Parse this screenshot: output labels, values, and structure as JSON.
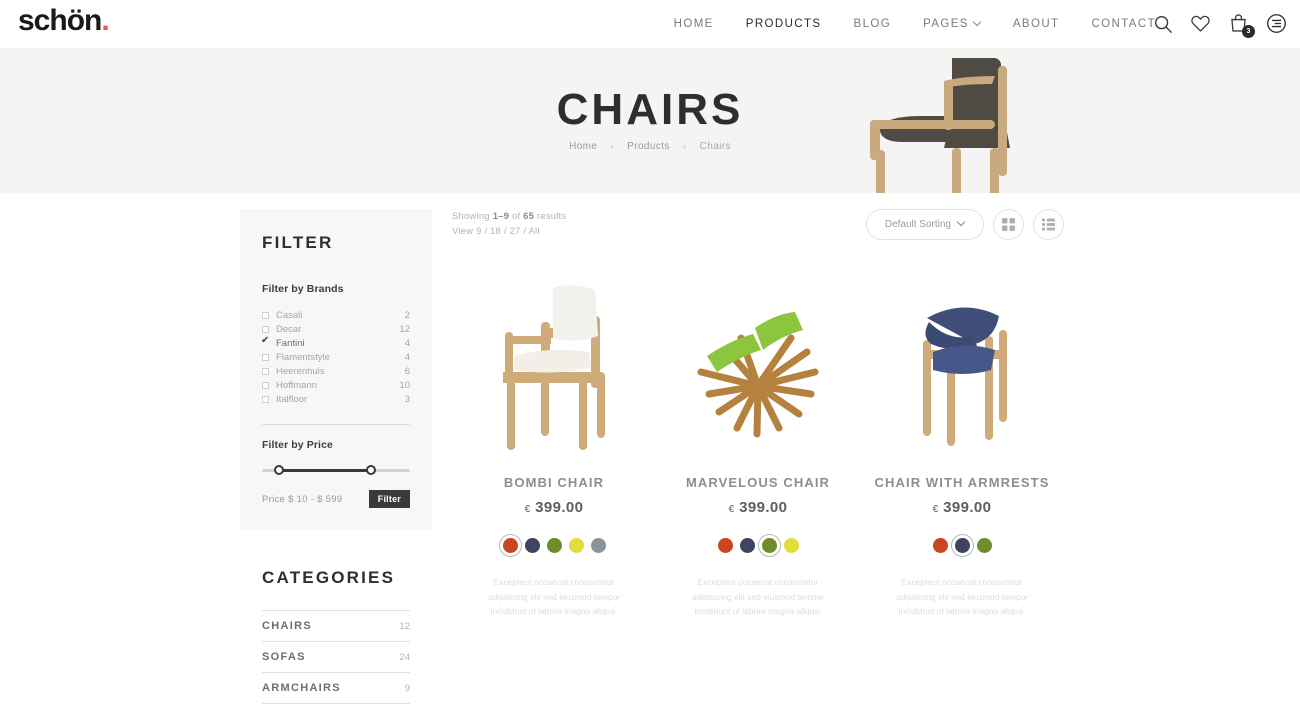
{
  "brand": {
    "name": "schön",
    "dot": "."
  },
  "nav": {
    "items": [
      {
        "label": "HOME",
        "active": false
      },
      {
        "label": "PRODUCTS",
        "active": true
      },
      {
        "label": "BLOG",
        "active": false
      },
      {
        "label": "PAGES",
        "active": false,
        "caret": true
      },
      {
        "label": "ABOUT",
        "active": false
      },
      {
        "label": "CONTACT",
        "active": false
      }
    ],
    "icons": [
      "search-icon",
      "wishlist-heart-icon",
      "cart-bag-icon",
      "menu-circle-icon"
    ],
    "cart_count": "3"
  },
  "hero": {
    "title": "CHAIRS",
    "breadcrumb": {
      "home": "Home",
      "products": "Products",
      "current": "Chairs",
      "separator": "›"
    }
  },
  "toolbar": {
    "showing_prefix": "Showing ",
    "showing_range": "1–9",
    "showing_mid": " of ",
    "showing_total": "65",
    "showing_suffix": " results",
    "view_label": "View 9 / 18 / 27 / All",
    "sort_label": "Default Sorting",
    "grid_view": "grid-view-icon",
    "list_view": "list-view-icon"
  },
  "filter": {
    "heading": "FILTER",
    "brands_label": "Filter by Brands",
    "brands": [
      {
        "name": "Casali",
        "count": "2",
        "checked": false
      },
      {
        "name": "Decar",
        "count": "12",
        "checked": false
      },
      {
        "name": "Fantini",
        "count": "4",
        "checked": true
      },
      {
        "name": "Flamentstyle",
        "count": "4",
        "checked": false
      },
      {
        "name": "Heerenhuis",
        "count": "6",
        "checked": false
      },
      {
        "name": "Hoffmann",
        "count": "10",
        "checked": false
      },
      {
        "name": "Italfloor",
        "count": "3",
        "checked": false
      }
    ],
    "price_label": "Filter by Price",
    "price_range_text": "Price  $ 10  -  $ 599",
    "price_min": "$ 10",
    "price_max": "$ 599",
    "filter_button": "Filter"
  },
  "categories": {
    "heading": "CATEGORIES",
    "items": [
      {
        "name": "CHAIRS",
        "count": "12"
      },
      {
        "name": "SOFAS",
        "count": "24"
      },
      {
        "name": "ARMCHAIRS",
        "count": "9"
      }
    ]
  },
  "products": [
    {
      "name": "BOMBI CHAIR",
      "currency": "€",
      "price": "399.00",
      "image": "bombi-chair-photo",
      "swatches": [
        "#c8451f",
        "#3d4361",
        "#6f8c2a",
        "#e2dc3c",
        "#8b9399"
      ],
      "selected_swatch": 0,
      "desc": "Excepteur occaecat consectetur adipisicing elit sed eiusmod tempor incididunt ut labore magna aliqua."
    },
    {
      "name": "MARVELOUS CHAIR",
      "currency": "€",
      "price": "399.00",
      "image": "marvelous-chair-photo",
      "swatches": [
        "#c8451f",
        "#3d4361",
        "#6f8c2a",
        "#e2dc3c"
      ],
      "selected_swatch": 2,
      "desc": "Excepteur occaecat consectetur adipisicing elit sed eiusmod tempor incididunt ut labore magna aliqua."
    },
    {
      "name": "CHAIR WITH ARMRESTS",
      "currency": "€",
      "price": "399.00",
      "image": "chair-with-armrests-photo",
      "swatches": [
        "#c8451f",
        "#3d4361",
        "#6f8c2a"
      ],
      "selected_swatch": 1,
      "desc": "Excepteur occaecat consectetur adipisicing elit sed eiusmod tempor incididunt ut labore magna aliqua."
    }
  ],
  "colors": {
    "accent": "#e8594a",
    "hero_bg": "#f4f4f2",
    "sidebar_bg": "#f7f7f6",
    "dark": "#3a3a3a"
  }
}
